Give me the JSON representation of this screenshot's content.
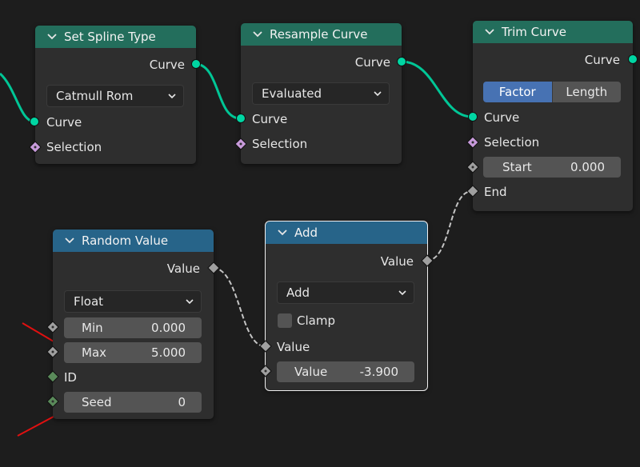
{
  "nodes": {
    "set_spline_type": {
      "title": "Set Spline Type",
      "output_curve": "Curve",
      "spline_type": "Catmull Rom",
      "input_curve": "Curve",
      "input_selection": "Selection"
    },
    "resample_curve": {
      "title": "Resample Curve",
      "output_curve": "Curve",
      "mode": "Evaluated",
      "input_curve": "Curve",
      "input_selection": "Selection"
    },
    "trim_curve": {
      "title": "Trim Curve",
      "output_curve": "Curve",
      "mode_factor": "Factor",
      "mode_length": "Length",
      "input_curve": "Curve",
      "input_selection": "Selection",
      "start_label": "Start",
      "start_value": "0.000",
      "end_label": "End"
    },
    "random_value": {
      "title": "Random Value",
      "output_value": "Value",
      "data_type": "Float",
      "min_label": "Min",
      "min_value": "0.000",
      "max_label": "Max",
      "max_value": "5.000",
      "id_label": "ID",
      "seed_label": "Seed",
      "seed_value": "0"
    },
    "add": {
      "title": "Add",
      "output_value": "Value",
      "operation": "Add",
      "clamp_label": "Clamp",
      "input_value": "Value",
      "value_label": "Value",
      "value_value": "-3.900"
    }
  },
  "colors": {
    "geometry_socket": "#00d6a3",
    "field_socket": "#a0a0a0",
    "selection_socket": "#c89bdb",
    "id_socket": "#5a8a5a",
    "header_geometry": "#236e5c",
    "header_utility": "#276489",
    "annotation_arrow": "#e01010"
  }
}
